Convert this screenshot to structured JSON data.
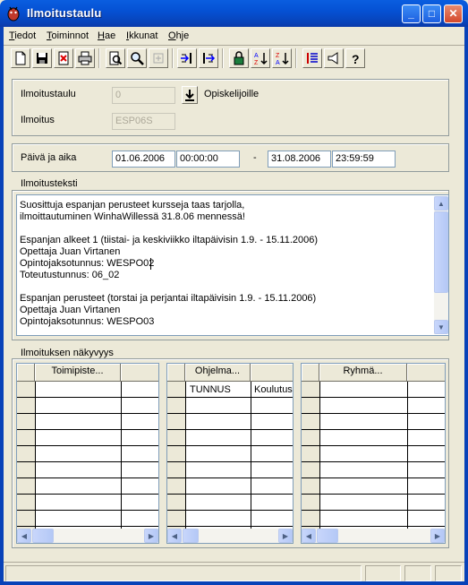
{
  "window": {
    "title": "Ilmoitustaulu",
    "icons": [
      "app-icon",
      "minimize-icon",
      "maximize-icon",
      "close-icon"
    ]
  },
  "menu": [
    "Tiedot",
    "Toiminnot",
    "Hae",
    "Ikkunat",
    "Ohje"
  ],
  "toolbar": {
    "buttons": [
      "new-icon",
      "save-icon",
      "delete-icon",
      "print-icon",
      "preview-icon",
      "search-icon",
      "insert-icon",
      "import-icon",
      "export-icon",
      "lock-icon",
      "sort-asc-icon",
      "sort-desc-icon",
      "list-icon",
      "broadcast-icon",
      "help-icon"
    ]
  },
  "header": {
    "board_label": "Ilmoitustaulu",
    "board_value": "0",
    "audience": "Opiskelijoille",
    "notice_label": "Ilmoitus",
    "notice_value": "ESP06S"
  },
  "datetime": {
    "label": "Päivä ja aika",
    "start_date": "01.06.2006",
    "start_time": "00:00:00",
    "separator": "-",
    "end_date": "31.08.2006",
    "end_time": "23:59:59"
  },
  "text": {
    "label": "Ilmoitusteksti",
    "lines": [
      "Suosittuja espanjan perusteet kursseja taas tarjolla,",
      "ilmoittautuminen WinhaWillessä 31.8.06 mennessä!",
      "",
      "Espanjan alkeet 1 (tiistai- ja keskiviikko iltapäivisin 1.9. - 15.11.2006)",
      "Opettaja Juan Virtanen",
      "Opintojaksotunnus: WESPO02",
      "Toteutustunnus: 06_02",
      "",
      "Espanjan perusteet  (torstai ja perjantai iltapäivisin 1.9. - 15.11.2006)",
      "Opettaja Juan Virtanen",
      "Opintojaksotunnus: WESPO03"
    ]
  },
  "visibility": {
    "label": "Ilmoituksen näkyvyys",
    "grid1": {
      "header": "Toimipiste..."
    },
    "grid2": {
      "header": "Ohjelma...",
      "row1": [
        "TUNNUS",
        "Koulutus"
      ]
    },
    "grid3": {
      "header": "Ryhmä..."
    }
  }
}
